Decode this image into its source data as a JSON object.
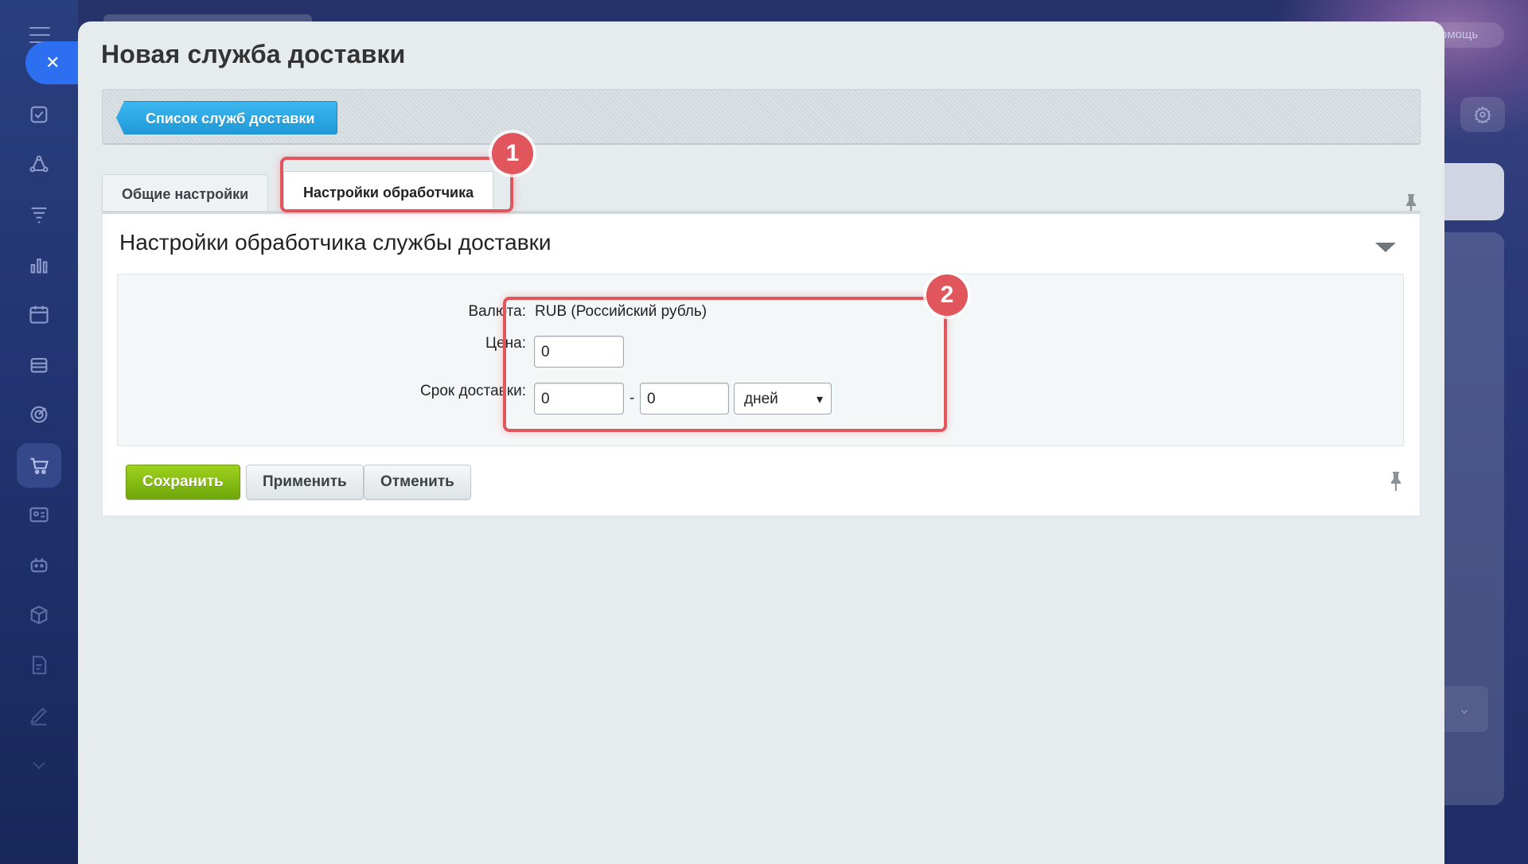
{
  "header": {
    "title": "Новая служба доставки",
    "help_label": "омощь"
  },
  "toolbar": {
    "back_label": "Список служб доставки"
  },
  "tabs": [
    {
      "label": "Общие настройки",
      "active": false
    },
    {
      "label": "Настройки обработчика",
      "active": true
    }
  ],
  "section": {
    "title": "Настройки обработчика службы доставки"
  },
  "form": {
    "currency_label": "Валюта:",
    "currency_value": "RUB (Российский рубль)",
    "price_label": "Цена:",
    "price_value": "0",
    "delivery_label": "Срок доставки:",
    "delivery_from": "0",
    "delivery_separator": "-",
    "delivery_to": "0",
    "delivery_unit": "дней"
  },
  "buttons": {
    "save": "Сохранить",
    "apply": "Применить",
    "cancel": "Отменить"
  },
  "annotations": {
    "badge1": "1",
    "badge2": "2",
    "color": "#e0565c"
  },
  "colors": {
    "accent_blue": "#1e9ad8",
    "save_green": "#6fa80d",
    "close_button": "#2c6ff0"
  }
}
